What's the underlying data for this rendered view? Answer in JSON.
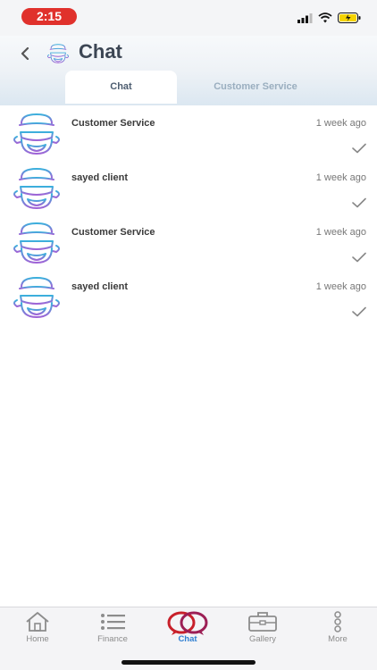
{
  "status_bar": {
    "time": "2:15",
    "battery_color": "#f5d300",
    "time_pill_color": "#e0312c"
  },
  "header": {
    "title": "Chat",
    "back_icon": "chevron-left-icon",
    "avatar_icon": "user-avatar-icon"
  },
  "tabs": [
    {
      "label": "Chat",
      "active": true
    },
    {
      "label": "Customer Service",
      "active": false
    }
  ],
  "chats": [
    {
      "name": "Customer Service",
      "time": "1 week ago",
      "status_icon": "check-icon"
    },
    {
      "name": "sayed client",
      "time": "1 week ago",
      "status_icon": "check-icon"
    },
    {
      "name": "Customer Service",
      "time": "1 week ago",
      "status_icon": "check-icon"
    },
    {
      "name": "sayed client",
      "time": "1 week ago",
      "status_icon": "check-icon"
    }
  ],
  "bottom_nav": [
    {
      "label": "Home",
      "icon": "home-icon",
      "active": false
    },
    {
      "label": "Finance",
      "icon": "list-icon",
      "active": false
    },
    {
      "label": "Chat",
      "icon": "chat-rings-icon",
      "active": true
    },
    {
      "label": "Gallery",
      "icon": "briefcase-icon",
      "active": false
    },
    {
      "label": "More",
      "icon": "more-dots-icon",
      "active": false
    }
  ],
  "colors": {
    "accent": "#2f7fd1",
    "chat_icon_red": "#c8202a",
    "avatar_blue": "#3aa7d8",
    "avatar_purple": "#9a6ed8"
  }
}
